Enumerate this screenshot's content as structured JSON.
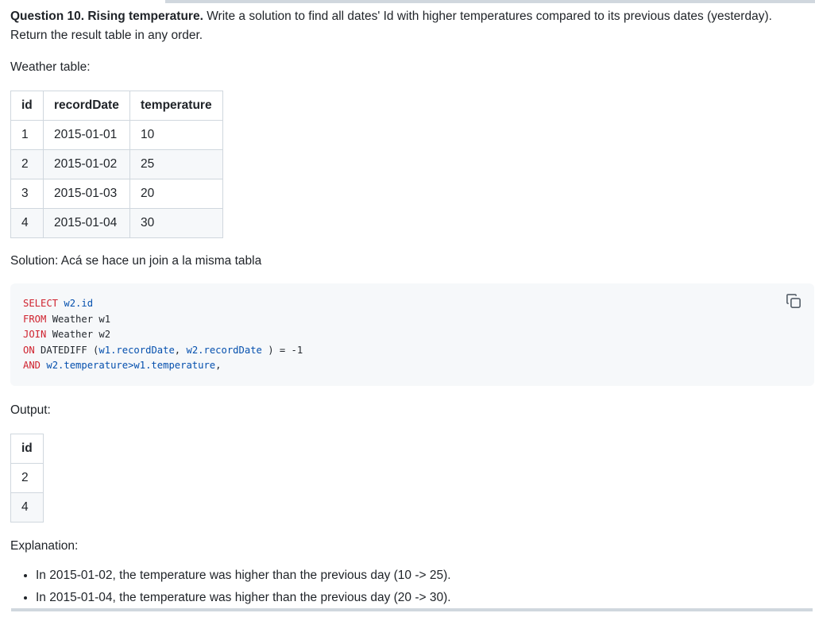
{
  "question": {
    "title": "Question 10. Rising temperature.",
    "text": " Write a solution to find all dates' Id with higher temperatures compared to its previous dates (yesterday). Return the result table in any order."
  },
  "weather_label": "Weather table:",
  "weather_table": {
    "headers": [
      "id",
      "recordDate",
      "temperature"
    ],
    "rows": [
      [
        "1",
        "2015-01-01",
        "10"
      ],
      [
        "2",
        "2015-01-02",
        "25"
      ],
      [
        "3",
        "2015-01-03",
        "20"
      ],
      [
        "4",
        "2015-01-04",
        "30"
      ]
    ]
  },
  "solution_label": "Solution: Acá se hace un join a la misma tabla",
  "code": {
    "tokens": [
      [
        "SELECT",
        " ",
        "w2.id"
      ],
      [
        "FROM",
        " Weather w1"
      ],
      [
        "JOIN",
        " Weather w2"
      ],
      [
        "ON",
        " DATEDIFF (",
        "w1.recordDate",
        ", ",
        "w2.recordDate",
        " ) = -1"
      ],
      [
        "AND",
        " ",
        "w2.temperature>w1.temperature",
        ","
      ]
    ],
    "copy_icon": "copy-icon"
  },
  "output_label": "Output:",
  "output_table": {
    "headers": [
      "id"
    ],
    "rows": [
      [
        "2"
      ],
      [
        "4"
      ]
    ]
  },
  "explanation_label": "Explanation:",
  "explanation_items": [
    "In 2015-01-02, the temperature was higher than the previous day (10 -> 25).",
    "In 2015-01-04, the temperature was higher than the previous day (20 -> 30)."
  ],
  "colors": {
    "keyword": "#cf222e",
    "identifier": "#0550ae",
    "code_bg": "#f6f8fa",
    "border": "#d0d7de"
  }
}
